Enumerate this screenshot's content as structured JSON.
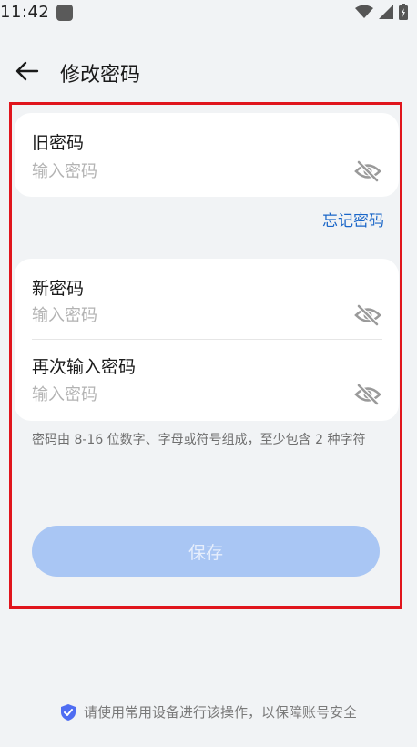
{
  "status_bar": {
    "time": "11:42",
    "icons": [
      "app-icon",
      "wifi-icon",
      "signal-icon",
      "battery-icon"
    ]
  },
  "header": {
    "title": "修改密码",
    "back_icon": "arrow-left-icon"
  },
  "old_password": {
    "label": "旧密码",
    "placeholder": "输入密码",
    "value": "",
    "visibility_icon": "eye-off-icon"
  },
  "forgot_password": "忘记密码",
  "new_password": {
    "label": "新密码",
    "placeholder": "输入密码",
    "value": "",
    "visibility_icon": "eye-off-icon"
  },
  "confirm_password": {
    "label": "再次输入密码",
    "placeholder": "输入密码",
    "value": "",
    "visibility_icon": "eye-off-icon"
  },
  "hint": "密码由 8-16 位数字、字母或符号组成，至少包含 2 种字符",
  "save_button": {
    "label": "保存",
    "enabled": false
  },
  "footer": {
    "notice": "请使用常用设备进行该操作，以保障账号安全",
    "icon": "shield-check-icon"
  },
  "colors": {
    "accent": "#1a66c8",
    "button_disabled": "#a9c6f4",
    "background": "#f1f3f5",
    "highlight": "#e0141c"
  }
}
